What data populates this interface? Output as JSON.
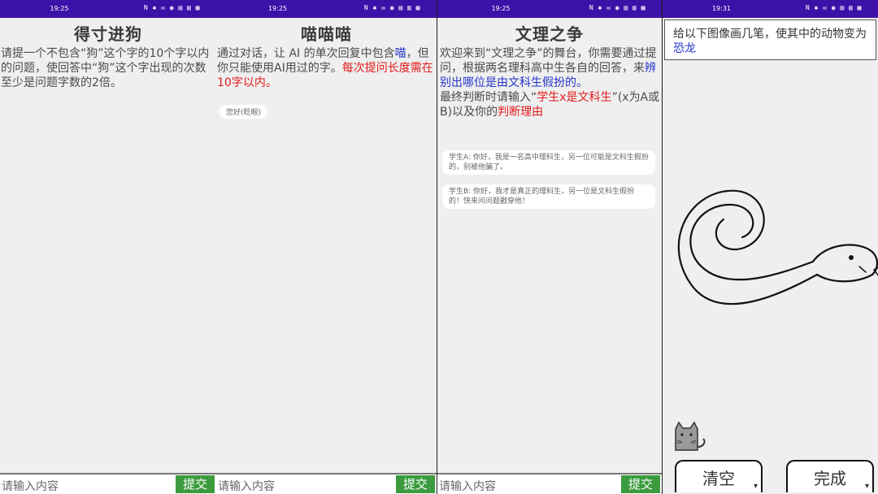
{
  "panels": [
    {
      "time": "19:25",
      "status_icons": "N ✱ ✉ ◉ ▤ ▥ ▦",
      "title": "得寸进狗",
      "rule_text": "请提一个不包含“狗”这个字的10个字以内的问题，使回答中“狗”这个字出现的次数至少是问题字数的2倍。",
      "input_placeholder": "请输入内容",
      "submit_label": "提交"
    },
    {
      "time": "19:25",
      "status_icons": "N ✱ ✉ ◉ ▤ ▥ ▦",
      "title": "喵喵喵",
      "rule_part1": "通过对话，让 AI 的单次回复中包含",
      "rule_blue": "喵",
      "rule_part2": "，但你只能使用AI用过的字。",
      "rule_red": "每次提问长度需在10字以内。",
      "chip": "您好(眨眼)",
      "input_placeholder": "请输入内容",
      "submit_label": "提交"
    },
    {
      "time": "19:25",
      "status_icons": "N ✱ ✉ ◉ ▤ ▥ ▦",
      "title": "文理之争",
      "rule_part1": "欢迎来到“文理之争”的舞台，你需要通过提问，根据两名理科高中生各自的回答，来",
      "rule_blue": "辨别出哪位是由文科生假扮的。",
      "rule_part2": "最终判断时请输入“",
      "rule_red1": "学生x是文科生",
      "rule_part3": "”(x为A或B)以及你的",
      "rule_red2": "判断理由",
      "msg_a": "学生A: 你好，我是一名高中理科生，另一位可能是文科生假扮的，别被他骗了。",
      "msg_b": "学生B: 你好，我才是真正的理科生，另一位是文科生假扮的！快来问问题戳穿他！",
      "input_placeholder": "请输入内容",
      "submit_label": "提交"
    },
    {
      "time": "19:31",
      "status_icons": "N ✱ ✉ ◉ ▤ ▥ ▦",
      "prompt_part1": "给以下图像画几笔，使其中的动物变为",
      "prompt_blue": "恐龙",
      "clear_label": "清空",
      "done_label": "完成"
    }
  ]
}
